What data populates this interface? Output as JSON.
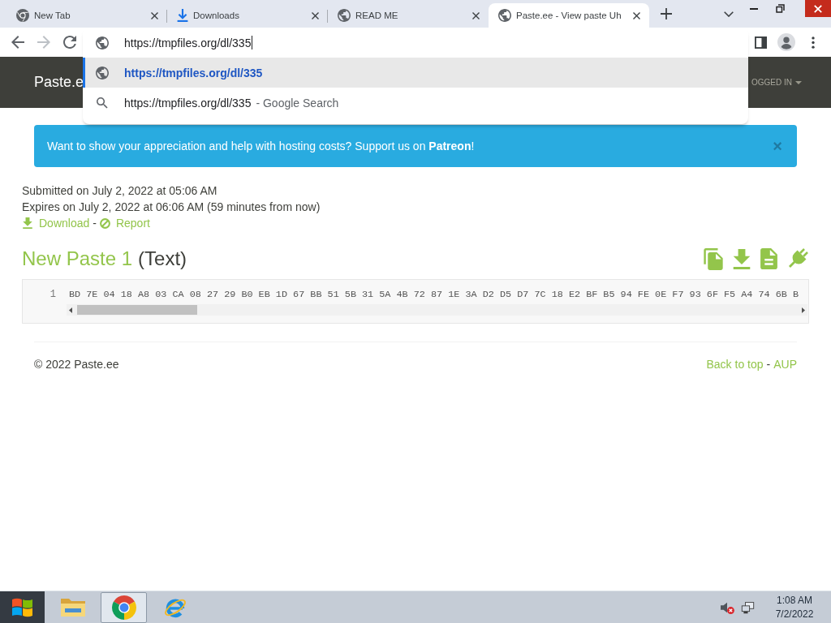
{
  "browser": {
    "tabs": [
      {
        "title": "New Tab",
        "kind": "chrome",
        "selected": false
      },
      {
        "title": "Downloads",
        "kind": "download",
        "selected": false
      },
      {
        "title": "READ ME",
        "kind": "globe",
        "selected": false
      },
      {
        "title": "Paste.ee - View paste Uh",
        "kind": "globe",
        "selected": true
      }
    ],
    "navigation": {
      "back": {
        "disabled": false
      },
      "forward": {
        "disabled": true
      }
    },
    "address_bar": {
      "value": "https://tmpfiles.org/dl/335"
    },
    "suggestions": [
      {
        "kind": "url",
        "text": "https://tmpfiles.org/dl/335",
        "selected": true
      },
      {
        "kind": "search",
        "text": "https://tmpfiles.org/dl/335",
        "suffix": "- Google Search",
        "selected": false
      }
    ]
  },
  "page": {
    "navbar": {
      "brand": "Paste.e",
      "user_menu": "OGGED IN"
    },
    "alert": {
      "message": "Want to show your appreciation and help with hosting costs? Support us on **Patreon**!",
      "close": "×"
    },
    "info": {
      "submitted": "Submitted on July 2, 2022 at 05:06 AM",
      "expires": "Expires on July 2, 2022 at 06:06 AM (59 minutes from now)",
      "links": [
        {
          "kind": "download",
          "label": "Download"
        },
        {
          "kind": "report",
          "label": "Report"
        }
      ],
      "separator": "-"
    },
    "paste": {
      "title": "New Paste 1",
      "format": "(Text)",
      "lines": [
        {
          "number": "1",
          "text": "BD 7E 04 18 A8 03 CA 08 27 29 B0 EB 1D 67 BB 51 5B 31 5A 4B 72 87 1E 3A D2 D5 D7 7C 18 E2 BF B5 94 FE 0E F7 93 6F F5 A4 74 6B B"
        }
      ]
    },
    "footer": {
      "copyright": "© 2022 Paste.ee",
      "links": [
        {
          "label": "Back to top"
        },
        {
          "label": "AUP"
        }
      ],
      "separator": "-"
    }
  },
  "taskbar": {
    "apps": [
      {
        "kind": "explorer",
        "selected": false
      },
      {
        "kind": "chrome",
        "selected": true
      },
      {
        "kind": "ie",
        "selected": false
      }
    ],
    "clock": {
      "time": "1:08 AM",
      "date": "7/2/2022"
    }
  }
}
